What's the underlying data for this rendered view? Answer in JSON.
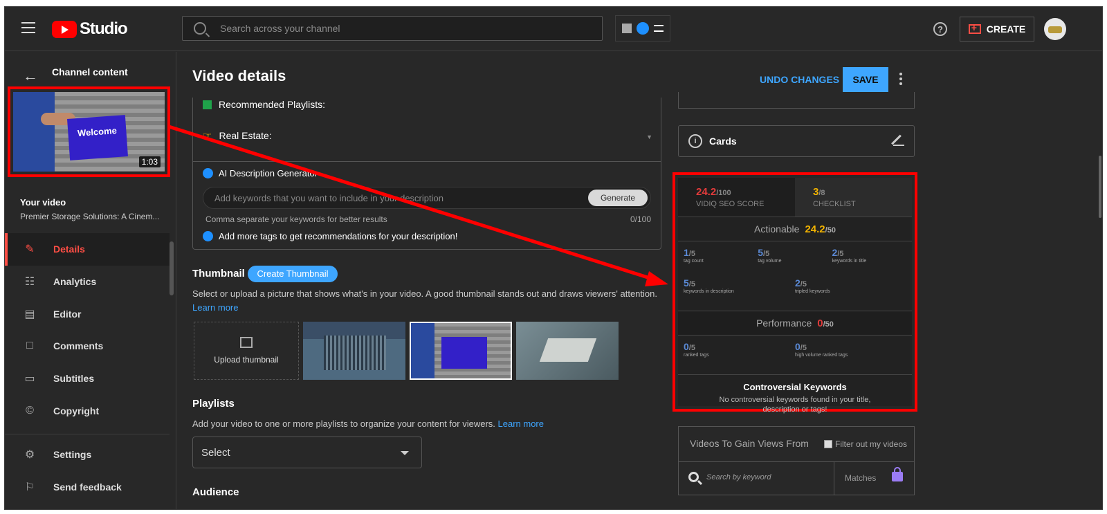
{
  "app": {
    "title": "Studio"
  },
  "search": {
    "placeholder": "Search across your channel"
  },
  "header": {
    "create_label": "CREATE",
    "help": "?"
  },
  "sidebar": {
    "back_title": "Channel content",
    "video_duration": "1:03",
    "thumb_text": "Welcome",
    "your_video_label": "Your video",
    "video_title": "Premier Storage Solutions: A Cinem...",
    "nav": [
      {
        "label": "Details",
        "icon": "pencil-icon",
        "active": true
      },
      {
        "label": "Analytics",
        "icon": "analytics-icon"
      },
      {
        "label": "Editor",
        "icon": "editor-icon"
      },
      {
        "label": "Comments",
        "icon": "comments-icon"
      },
      {
        "label": "Subtitles",
        "icon": "subtitles-icon"
      },
      {
        "label": "Copyright",
        "icon": "copyright-icon"
      }
    ],
    "nav_bottom": [
      {
        "label": "Settings",
        "icon": "gear-icon"
      },
      {
        "label": "Send feedback",
        "icon": "feedback-icon"
      }
    ]
  },
  "main": {
    "title": "Video details",
    "undo_label": "UNDO CHANGES",
    "save_label": "SAVE",
    "description": {
      "recommended_playlists": "Recommended Playlists:",
      "real_estate": "Real Estate:",
      "ai_header": "AI Description Generator",
      "ai_placeholder": "Add keywords that you want to include in your description",
      "generate_label": "Generate",
      "hint": "Comma separate your keywords for better results",
      "count": "0/100",
      "more_tags": "Add more tags to get recommendations for your description!"
    },
    "thumbnail": {
      "title": "Thumbnail",
      "create_label": "Create Thumbnail",
      "desc": "Select or upload a picture that shows what's in your video. A good thumbnail stands out and draws viewers' attention.",
      "learn_more": "Learn more",
      "upload_label": "Upload thumbnail"
    },
    "playlists": {
      "title": "Playlists",
      "desc": "Add your video to one or more playlists to organize your content for viewers.",
      "learn_more": "Learn more",
      "select_label": "Select"
    },
    "audience": {
      "title": "Audience"
    }
  },
  "right": {
    "cards_label": "Cards",
    "seo": {
      "score": "24.2",
      "score_den": "/100",
      "score_label": "VIDIQ SEO SCORE",
      "checklist": "3",
      "checklist_den": "/8",
      "checklist_label": "CHECKLIST",
      "actionable_label": "Actionable",
      "actionable_value": "24.2",
      "actionable_den": "/50",
      "metrics": [
        {
          "value": "1",
          "den": "/5",
          "label": "tag count",
          "color": "#5b8ad6"
        },
        {
          "value": "5",
          "den": "/5",
          "label": "tag volume",
          "color": "#5b8ad6"
        },
        {
          "value": "2",
          "den": "/5",
          "label": "keywords in title",
          "color": "#5b8ad6"
        },
        {
          "value": "5",
          "den": "/5",
          "label": "keywords in description",
          "color": "#5b8ad6"
        },
        {
          "value": "2",
          "den": "/5",
          "label": "tripled keywords",
          "color": "#5b8ad6"
        }
      ],
      "performance_label": "Performance",
      "performance_value": "0",
      "performance_den": "/50",
      "perf_metrics": [
        {
          "value": "0",
          "den": "/5",
          "label": "ranked tags"
        },
        {
          "value": "0",
          "den": "/5",
          "label": "high volume ranked tags"
        }
      ],
      "controversial_title": "Controversial Keywords",
      "controversial_desc_1": "No controversial keywords found in your title,",
      "controversial_desc_2": "description or tags!"
    },
    "gain": {
      "title": "Videos To Gain Views From",
      "filter_label": "Filter out my videos",
      "search_placeholder": "Search by keyword",
      "matches_label": "Matches"
    }
  },
  "colors": {
    "accent_red": "#ff4e45",
    "link_blue": "#3ea6ff",
    "score_red": "#e23b3b",
    "score_yellow": "#f4b400",
    "annotation_red": "#ff0000"
  }
}
